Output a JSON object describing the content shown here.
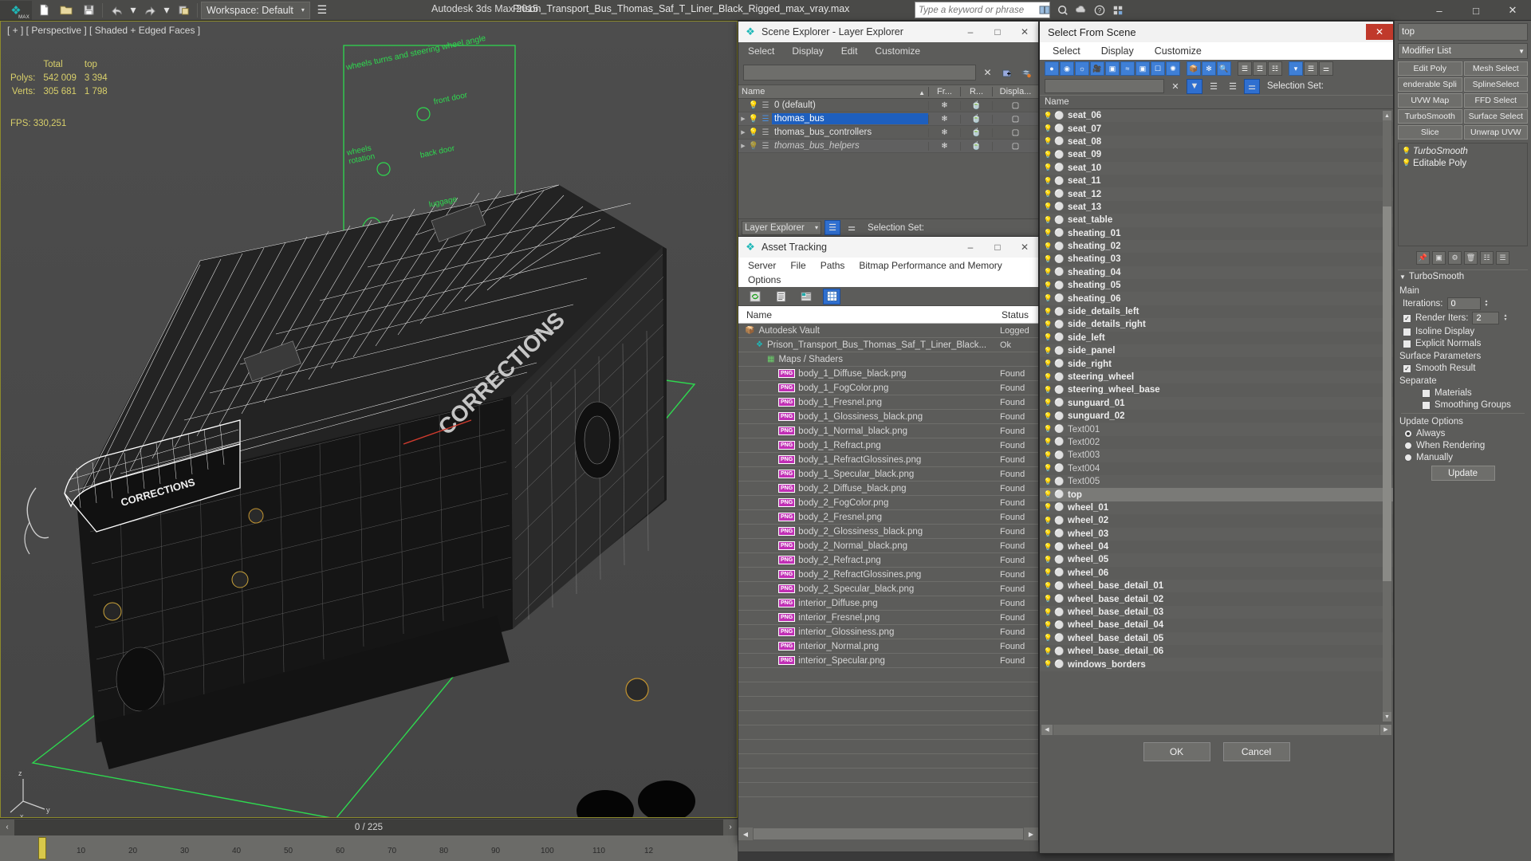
{
  "app": {
    "product": "Autodesk 3ds Max  2015",
    "file": "Prison_Transport_Bus_Thomas_Saf_T_Liner_Black_Rigged_max_vray.max",
    "workspace": "Workspace: Default",
    "search_placeholder": "Type a keyword or phrase"
  },
  "window_controls": {
    "minimize": "–",
    "maximize": "□",
    "close": "✕"
  },
  "viewport": {
    "label": "[ + ] [ Perspective ] [ Shaded + Edged Faces ]",
    "stats": {
      "col_total": "Total",
      "col_top": "top",
      "rows": [
        {
          "label": "Polys:",
          "total": "542 009",
          "top": "3 394"
        },
        {
          "label": "Verts:",
          "total": "305 681",
          "top": "1 798"
        }
      ]
    },
    "fps": "FPS:  330,251",
    "annotations": [
      "wheels turns and steering wheel angle",
      "front door",
      "wheels rotation",
      "back door",
      "luggage"
    ],
    "model_text": "CORRECTIONS"
  },
  "trackbar": {
    "prev": "‹",
    "next": "›",
    "frame": "0 / 225"
  },
  "ruler": {
    "ticks": [
      "10",
      "20",
      "30",
      "40",
      "50",
      "60",
      "70",
      "80",
      "90",
      "100",
      "110",
      "12"
    ]
  },
  "scene_explorer": {
    "title": "Scene Explorer - Layer Explorer",
    "menus": [
      "Select",
      "Display",
      "Edit",
      "Customize"
    ],
    "columns": [
      "Name",
      "Fr...",
      "R...",
      "Displa..."
    ],
    "rows": [
      {
        "name": "0 (default)",
        "selected": false,
        "expandable": false,
        "bulb": "on",
        "italic": false
      },
      {
        "name": "thomas_bus",
        "selected": true,
        "expandable": true,
        "bulb": "on",
        "italic": false
      },
      {
        "name": "thomas_bus_controllers",
        "selected": false,
        "expandable": true,
        "bulb": "on",
        "italic": false
      },
      {
        "name": "thomas_bus_helpers",
        "selected": false,
        "expandable": true,
        "bulb": "off",
        "italic": true
      }
    ],
    "footer": {
      "mode": "Layer Explorer",
      "selection_set_label": "Selection Set:"
    }
  },
  "asset_tracking": {
    "title": "Asset Tracking",
    "menus_row1": [
      "Server",
      "File",
      "Paths",
      "Bitmap Performance and Memory"
    ],
    "menus_row2": [
      "Options"
    ],
    "columns": {
      "name": "Name",
      "status": "Status"
    },
    "rows": [
      {
        "name": "Autodesk Vault",
        "status": "Logged",
        "indent": 0,
        "kind": "vault"
      },
      {
        "name": "Prison_Transport_Bus_Thomas_Saf_T_Liner_Black...",
        "status": "Ok",
        "indent": 1,
        "kind": "max"
      },
      {
        "name": "Maps / Shaders",
        "status": "",
        "indent": 2,
        "kind": "maps"
      },
      {
        "name": "body_1_Diffuse_black.png",
        "status": "Found",
        "indent": 3,
        "kind": "png"
      },
      {
        "name": "body_1_FogColor.png",
        "status": "Found",
        "indent": 3,
        "kind": "png"
      },
      {
        "name": "body_1_Fresnel.png",
        "status": "Found",
        "indent": 3,
        "kind": "png"
      },
      {
        "name": "body_1_Glossiness_black.png",
        "status": "Found",
        "indent": 3,
        "kind": "png"
      },
      {
        "name": "body_1_Normal_black.png",
        "status": "Found",
        "indent": 3,
        "kind": "png"
      },
      {
        "name": "body_1_Refract.png",
        "status": "Found",
        "indent": 3,
        "kind": "png"
      },
      {
        "name": "body_1_RefractGlossines.png",
        "status": "Found",
        "indent": 3,
        "kind": "png"
      },
      {
        "name": "body_1_Specular_black.png",
        "status": "Found",
        "indent": 3,
        "kind": "png"
      },
      {
        "name": "body_2_Diffuse_black.png",
        "status": "Found",
        "indent": 3,
        "kind": "png"
      },
      {
        "name": "body_2_FogColor.png",
        "status": "Found",
        "indent": 3,
        "kind": "png"
      },
      {
        "name": "body_2_Fresnel.png",
        "status": "Found",
        "indent": 3,
        "kind": "png"
      },
      {
        "name": "body_2_Glossiness_black.png",
        "status": "Found",
        "indent": 3,
        "kind": "png"
      },
      {
        "name": "body_2_Normal_black.png",
        "status": "Found",
        "indent": 3,
        "kind": "png"
      },
      {
        "name": "body_2_Refract.png",
        "status": "Found",
        "indent": 3,
        "kind": "png"
      },
      {
        "name": "body_2_RefractGlossines.png",
        "status": "Found",
        "indent": 3,
        "kind": "png"
      },
      {
        "name": "body_2_Specular_black.png",
        "status": "Found",
        "indent": 3,
        "kind": "png"
      },
      {
        "name": "interior_Diffuse.png",
        "status": "Found",
        "indent": 3,
        "kind": "png"
      },
      {
        "name": "interior_Fresnel.png",
        "status": "Found",
        "indent": 3,
        "kind": "png"
      },
      {
        "name": "interior_Glossiness.png",
        "status": "Found",
        "indent": 3,
        "kind": "png"
      },
      {
        "name": "interior_Normal.png",
        "status": "Found",
        "indent": 3,
        "kind": "png"
      },
      {
        "name": "interior_Specular.png",
        "status": "Found",
        "indent": 3,
        "kind": "png"
      }
    ]
  },
  "select_from_scene": {
    "title": "Select From Scene",
    "menus": [
      "Select",
      "Display",
      "Customize"
    ],
    "column_name": "Name",
    "find_value": "",
    "items": [
      "seat_06",
      "seat_07",
      "seat_08",
      "seat_09",
      "seat_10",
      "seat_11",
      "seat_12",
      "seat_13",
      "seat_table",
      "sheating_01",
      "sheating_02",
      "sheating_03",
      "sheating_04",
      "sheating_05",
      "sheating_06",
      "side_details_left",
      "side_details_right",
      "side_left",
      "side_panel",
      "side_right",
      "steering_wheel",
      "steering_wheel_base",
      "sunguard_01",
      "sunguard_02",
      "Text001",
      "Text002",
      "Text003",
      "Text004",
      "Text005",
      "top",
      "wheel_01",
      "wheel_02",
      "wheel_03",
      "wheel_04",
      "wheel_05",
      "wheel_06",
      "wheel_base_detail_01",
      "wheel_base_detail_02",
      "wheel_base_detail_03",
      "wheel_base_detail_04",
      "wheel_base_detail_05",
      "wheel_base_detail_06",
      "windows_borders"
    ],
    "dim_items": [
      "Text001",
      "Text002",
      "Text003",
      "Text004",
      "Text005"
    ],
    "selected_item": "top",
    "ok_label": "OK",
    "cancel_label": "Cancel"
  },
  "command_panel": {
    "object_name": "top",
    "modifier_list_label": "Modifier List",
    "buttons": [
      "Edit Poly",
      "Mesh Select",
      "enderable Spli",
      "SplineSelect",
      "UVW Map",
      "FFD Select",
      "TurboSmooth",
      "Surface Select",
      "Slice",
      "Unwrap UVW"
    ],
    "stack": [
      {
        "label": "TurboSmooth",
        "italic": true,
        "bulb": true
      },
      {
        "label": "Editable Poly",
        "italic": false,
        "bulb": true
      }
    ],
    "rollout_title": "TurboSmooth",
    "sections": {
      "main": "Main",
      "iterations_label": "Iterations:",
      "iterations_value": "0",
      "render_iters_label": "Render Iters:",
      "render_iters_value": "2",
      "render_iters_checked": true,
      "isoline_display": "Isoline Display",
      "isoline_checked": false,
      "explicit_normals": "Explicit Normals",
      "explicit_checked": false,
      "surface_parameters": "Surface Parameters",
      "smooth_result": "Smooth Result",
      "smooth_result_checked": true,
      "separate": "Separate",
      "materials": "Materials",
      "materials_checked": false,
      "smoothing_groups": "Smoothing Groups",
      "smoothing_groups_checked": false,
      "update_options": "Update Options",
      "always": "Always",
      "when_rendering": "When Rendering",
      "manually": "Manually",
      "update_mode": "Always",
      "update_button": "Update"
    }
  }
}
